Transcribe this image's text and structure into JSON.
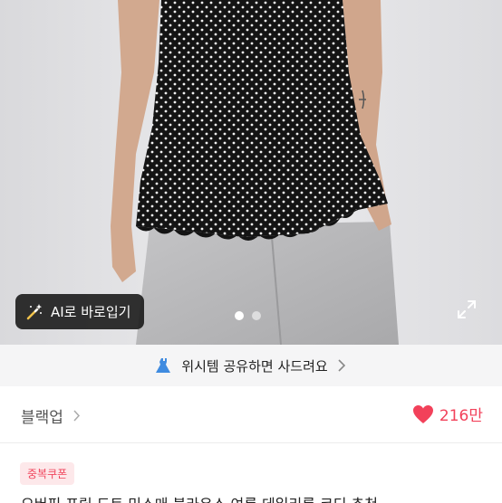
{
  "photo": {
    "ai_button_label": "AI로 바로입기",
    "icons": {
      "ai_button": "magic-wand-icon",
      "expand": "expand-icon"
    },
    "carousel": {
      "total": 2,
      "active_index": 0
    }
  },
  "wish_banner": {
    "text": "위시템 공유하면 사드려요",
    "icons": {
      "lead": "dress-icon",
      "trail": "chevron-right-icon"
    },
    "icon_color": "#3f8be0"
  },
  "product": {
    "category": "블랙업",
    "likes": "216만",
    "like_color": "#f2415a"
  },
  "coupon": {
    "label": "중복쿠폰",
    "bg": "#fde8ea",
    "color": "#f0465d"
  },
  "description_cut": "오버핏 프릴 도트 민소매 블라우스 여름 데일리룩 코디 추천"
}
